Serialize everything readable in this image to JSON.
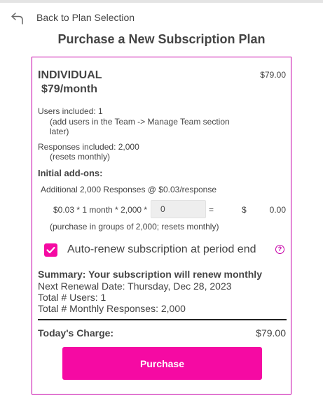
{
  "nav": {
    "back_label": "Back to Plan Selection",
    "back_icon": "undo-arrow-icon"
  },
  "page": {
    "title": "Purchase a New Subscription Plan"
  },
  "plan": {
    "name": "INDIVIDUAL",
    "price": "$79/month",
    "amount": "$79.00",
    "users_label": "Users included: 1",
    "users_note_line1": "(add users in the Team -> Manage Team section",
    "users_note_line2": "later)",
    "responses_label": "Responses included: 2,000",
    "responses_note": "(resets monthly)"
  },
  "addons": {
    "heading": "Initial add-ons:",
    "item_label": "Additional 2,000 Responses @ $0.03/response",
    "formula": "$0.03 * 1 month * 2,000 *",
    "quantity_value": "0",
    "equals": "=",
    "currency": "$",
    "total": "0.00",
    "note": "(purchase in groups of 2,000; resets monthly)"
  },
  "autorenew": {
    "checked": true,
    "label": "Auto-renew subscription at period end",
    "help_glyph": "?"
  },
  "summary": {
    "title": "Summary: Your subscription will renew monthly",
    "renewal": "Next Renewal Date: Thursday, Dec 28, 2023",
    "users": "Total # Users: 1",
    "responses": "Total # Monthly Responses: 2,000"
  },
  "charge": {
    "label": "Today's Charge:",
    "amount": "$79.00"
  },
  "purchase": {
    "label": "Purchase"
  },
  "colors": {
    "accent": "#f50aa3",
    "border": "#c600a8",
    "text": "#444444",
    "topbar": "#e4e4e4"
  }
}
